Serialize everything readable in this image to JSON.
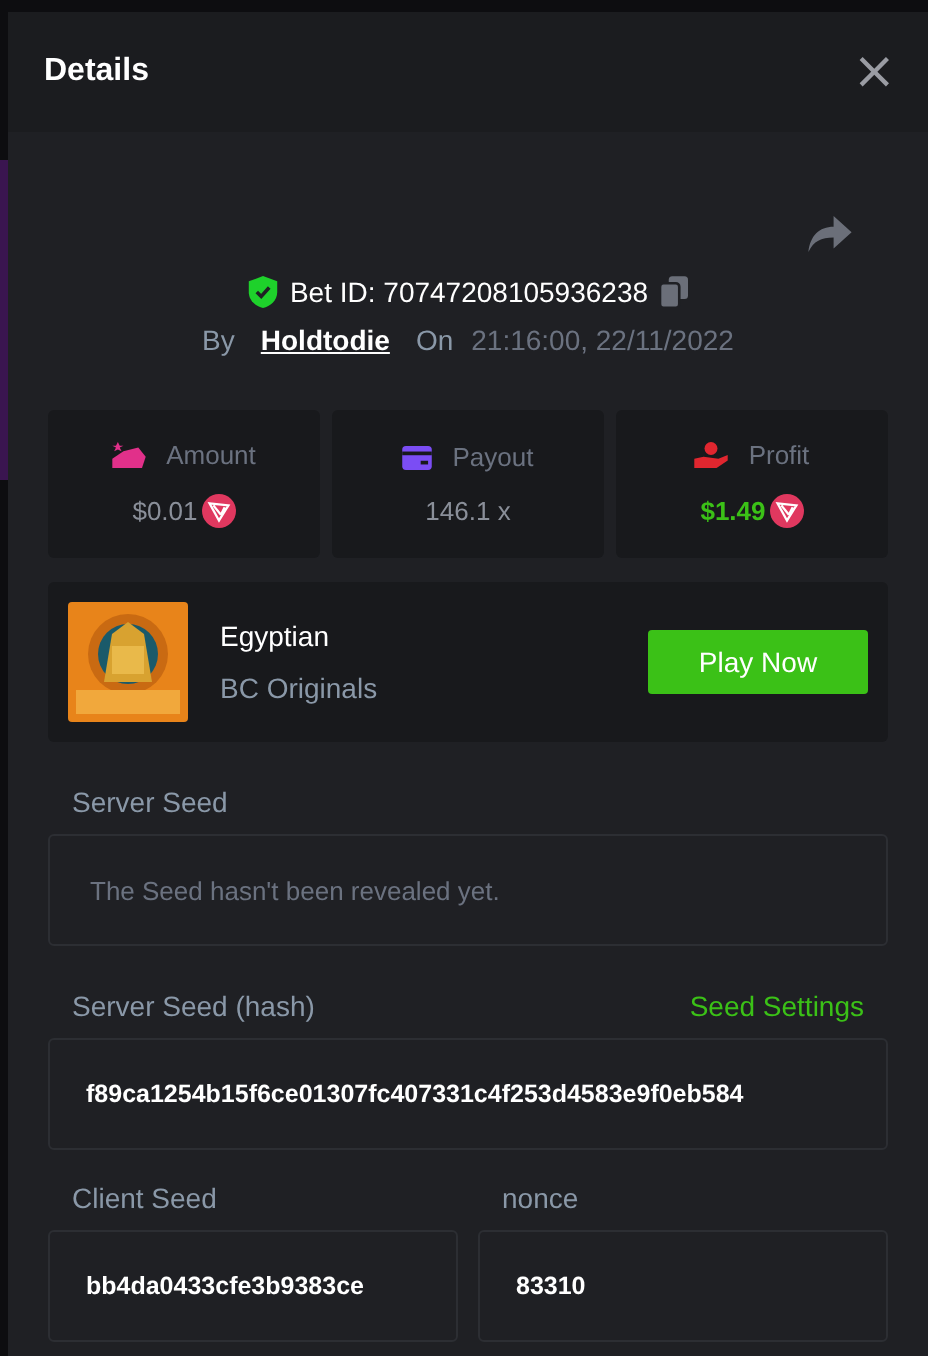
{
  "modal": {
    "title": "Details",
    "close": "×"
  },
  "bet": {
    "verified": true,
    "label": "Bet ID: 70747208105936238",
    "by_label": "By",
    "user": "Holdtodie",
    "on_label": "On",
    "time": "21:16:00, 22/11/2022"
  },
  "stats": [
    {
      "kind": "amount",
      "label": "Amount",
      "value": "$0.01",
      "coin": true,
      "positive": false
    },
    {
      "kind": "payout",
      "label": "Payout",
      "value": "146.1 x",
      "coin": false,
      "positive": false
    },
    {
      "kind": "profit",
      "label": "Profit",
      "value": "$1.49",
      "coin": true,
      "positive": true
    }
  ],
  "game": {
    "name": "Egyptian",
    "provider": "BC Originals",
    "button": "Play Now"
  },
  "server_seed": {
    "label": "Server Seed",
    "placeholder": "The Seed hasn't been revealed yet."
  },
  "server_seed_hash": {
    "label": "Server Seed (hash)",
    "link": "Seed Settings",
    "value": "f89ca1254b15f6ce01307fc407331c4f253d4583e9f0eb584"
  },
  "client_seed": {
    "label": "Client Seed",
    "value": "bb4da0433cfe3b9383ce"
  },
  "nonce": {
    "label": "nonce",
    "value": "83310"
  }
}
